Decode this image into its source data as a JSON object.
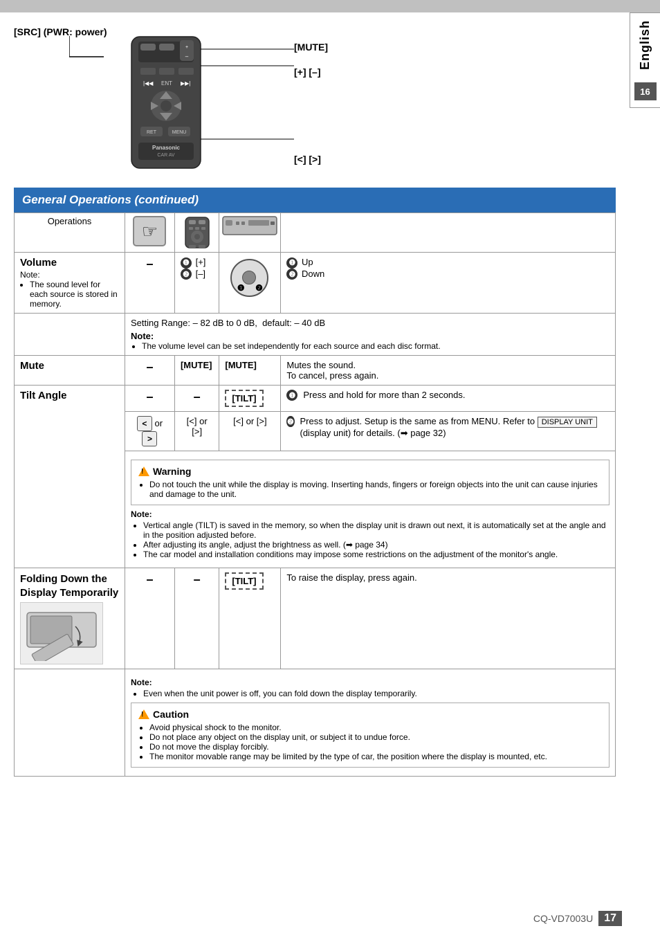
{
  "top_bar": {},
  "side_tab": {
    "language": "English",
    "page": "16"
  },
  "remote_section": {
    "src_label": "[SRC] (PWR: power)",
    "mute_label": "[MUTE]",
    "plus_minus_label": "[+] [–]",
    "arrows_label": "[<] [>]"
  },
  "section_header": {
    "title": "General Operations (continued)"
  },
  "table": {
    "col_headers": [
      "Operations",
      "",
      "",
      ""
    ],
    "rows": [
      {
        "feature": "Volume",
        "note_label": "Note:",
        "notes": [
          "The sound level for each source is stored in memory."
        ],
        "col2": "–",
        "col3_items": [
          "[+]",
          "[–]"
        ],
        "col4_content": "dial",
        "col5_items": [
          "Up",
          "Down"
        ],
        "setting_range": "Setting Range: – 82 dB to 0 dB,  default: – 40 dB",
        "note2_label": "Note:",
        "note2_items": [
          "The volume level can be set independently for each source and each disc format."
        ]
      },
      {
        "feature": "Mute",
        "col2": "–",
        "col3": "[MUTE]",
        "col4": "[MUTE]",
        "col5": "Mutes the sound.\nTo cancel, press again."
      },
      {
        "feature": "Tilt Angle",
        "col2_upper": "–",
        "col3_upper": "–",
        "col4_upper": "[TILT]",
        "col5_upper": "Press and hold for more than 2 seconds.",
        "col5_lower": "Press to adjust. Setup is the same as from MENU. Refer to DISPLAY UNIT (display unit) for details. (➡ page 32)",
        "col2_lower": "< or >",
        "col3_lower": "[<] or [>]",
        "col4_lower": "[<] or [>]",
        "warning": {
          "title": "Warning",
          "items": [
            "Do not touch the unit while the display is moving. Inserting hands, fingers or foreign objects into the unit can cause injuries and damage to the unit."
          ]
        },
        "note_label": "Note:",
        "notes": [
          "Vertical angle (TILT) is saved in the memory, so when the display unit is drawn out next, it is automatically set at the angle and in the position adjusted before.",
          "After adjusting its angle, adjust the brightness as well. (➡ page 34)",
          "The car model and installation conditions may impose some restrictions on the adjustment of the monitor's angle."
        ]
      },
      {
        "feature": "Folding Down the Display Temporarily",
        "col2": "–",
        "col3": "–",
        "col4": "[TILT]",
        "col5": "To raise the display, press again.",
        "note_label": "Note:",
        "notes": [
          "Even when the unit power is off, you can fold down the display temporarily."
        ],
        "caution": {
          "title": "Caution",
          "items": [
            "Avoid physical shock to the monitor.",
            "Do not place any object on the display unit, or subject it to undue force.",
            "Do not move the display forcibly.",
            "The monitor movable range may be limited by the type of car, the position where the display is mounted, etc."
          ]
        }
      }
    ]
  },
  "bottom": {
    "product_code": "CQ-VD7003U",
    "page_number": "17"
  }
}
